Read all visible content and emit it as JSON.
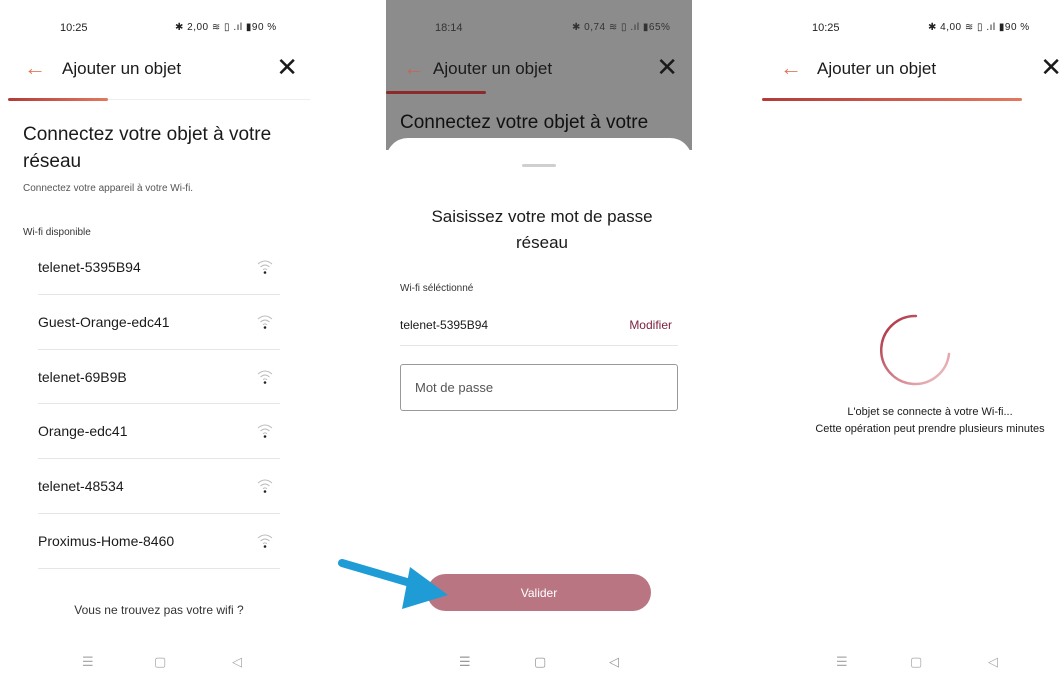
{
  "screen1": {
    "status": {
      "time": "10:25",
      "icons": "✱ 2,00 ≋ ▯ .ıl ▮90 %"
    },
    "header": {
      "title": "Ajouter un objet"
    },
    "progress": {
      "fraction": 0.33
    },
    "heading": "Connectez votre objet à votre réseau",
    "subtitle": "Connectez votre appareil à votre Wi-fi.",
    "section_label": "Wi-fi disponible",
    "networks": [
      {
        "name": "telenet-5395B94"
      },
      {
        "name": "Guest-Orange-edc41"
      },
      {
        "name": "telenet-69B9B"
      },
      {
        "name": "Orange-edc41"
      },
      {
        "name": "telenet-48534"
      },
      {
        "name": "Proximus-Home-8460"
      }
    ],
    "not_found_link": "Vous ne trouvez pas votre wifi ?"
  },
  "screen2": {
    "status": {
      "time": "18:14",
      "icons": "✱ 0,74 ≋ ▯ .ıl ▮65%"
    },
    "header": {
      "title": "Ajouter un objet"
    },
    "dim_heading": "Connectez votre objet à votre",
    "sheet": {
      "title": "Saisissez votre mot de passe réseau",
      "selected_label": "Wi-fi séléctionné",
      "selected_network": "telenet-5395B94",
      "modify_label": "Modifier",
      "password_placeholder": "Mot de passe",
      "submit_label": "Valider"
    }
  },
  "screen3": {
    "status": {
      "time": "10:25",
      "icons": "✱ 4,00 ≋ ▯ .ıl ▮90 %"
    },
    "header": {
      "title": "Ajouter un objet"
    },
    "progress": {
      "fraction": 1.0
    },
    "message_line1": "L'objet se connecte à votre Wi-fi...",
    "message_line2": "Cette opération peut prendre plusieurs minutes"
  },
  "nav": {
    "menu": "☰",
    "home": "▢",
    "back": "◁"
  },
  "colors": {
    "accent": "#e07a5f",
    "brand_dark": "#7a1f3d",
    "button": "#b97682",
    "arrow": "#1f9bd6"
  }
}
